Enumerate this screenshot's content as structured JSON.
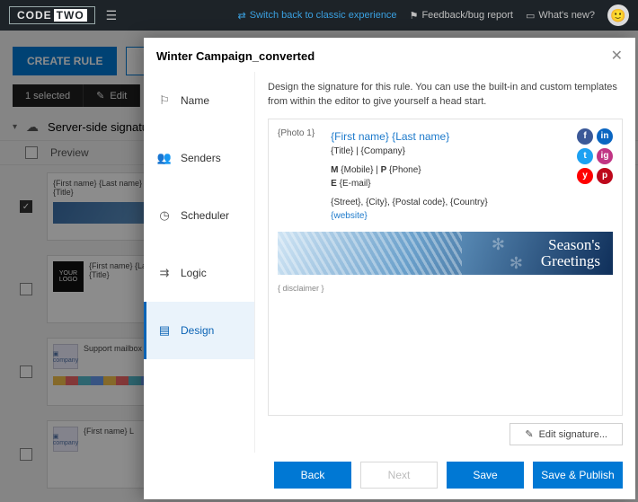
{
  "brand": {
    "part1": "CODE",
    "part2": "TWO"
  },
  "top": {
    "switch": "Switch back to classic experience",
    "feedback": "Feedback/bug report",
    "whatsnew": "What's new?"
  },
  "bg": {
    "create": "CREATE RULE",
    "selected": "1 selected",
    "edit": "Edit",
    "section": "Server-side signatures",
    "col_preview": "Preview",
    "card1_text": "{First name} {Last name}\n{Title}",
    "card2_text": "{First name} {Last name}\n{Title}",
    "card3_text": "Support mailbox"
  },
  "modal": {
    "title": "Winter Campaign_converted",
    "steps": [
      {
        "label": "Name"
      },
      {
        "label": "Senders"
      },
      {
        "label": "Scheduler"
      },
      {
        "label": "Logic"
      },
      {
        "label": "Design"
      }
    ],
    "description": "Design the signature for this rule. You can use the built-in and custom templates from within the editor to give yourself a head start.",
    "signature": {
      "photo": "{Photo 1}",
      "name": "{First name} {Last name}",
      "titleline": "{Title} | {Company}",
      "phoneline_bold_m": "M",
      "phoneline_rest_m": " {Mobile} | ",
      "phoneline_bold_p": "P",
      "phoneline_rest_p": " {Phone}",
      "email_bold": "E",
      "email_rest": " {E-mail}",
      "addr": "{Street}, {City}, {Postal code}, {Country}",
      "website": "{website}",
      "banner_l1": "Season's",
      "banner_l2": "Greetings",
      "disclaimer": "{ disclaimer }"
    },
    "socials": [
      {
        "letter": "f",
        "color": "#3b5998"
      },
      {
        "letter": "in",
        "color": "#0a66c2"
      },
      {
        "letter": "t",
        "color": "#1da1f2"
      },
      {
        "letter": "ig",
        "color": "#c13584"
      },
      {
        "letter": "y",
        "color": "#ff0000"
      },
      {
        "letter": "p",
        "color": "#bd081c"
      }
    ],
    "edit": "Edit signature...",
    "buttons": {
      "back": "Back",
      "next": "Next",
      "save": "Save",
      "publish": "Save & Publish"
    }
  }
}
